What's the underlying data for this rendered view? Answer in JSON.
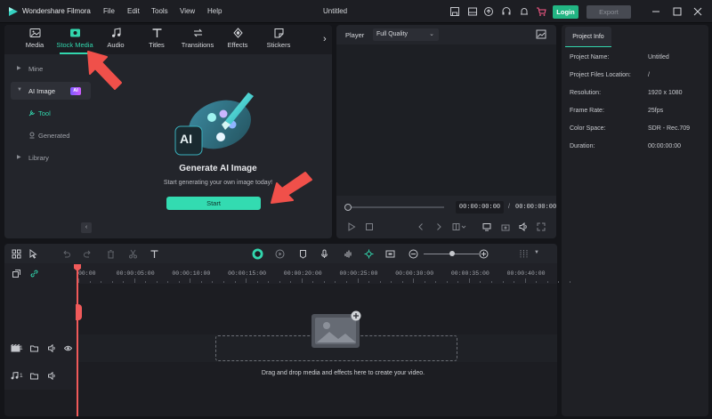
{
  "titlebar": {
    "app_name": "Wondershare Filmora",
    "menu": [
      "File",
      "Edit",
      "Tools",
      "View",
      "Help"
    ],
    "window_title": "Untitled",
    "login_label": "Login",
    "export_label": "Export"
  },
  "tabs": [
    {
      "label": "Media",
      "icon": "media-icon"
    },
    {
      "label": "Stock Media",
      "icon": "stock-media-icon",
      "active": true
    },
    {
      "label": "Audio",
      "icon": "audio-icon"
    },
    {
      "label": "Titles",
      "icon": "titles-icon"
    },
    {
      "label": "Transitions",
      "icon": "transitions-icon"
    },
    {
      "label": "Effects",
      "icon": "effects-icon"
    },
    {
      "label": "Stickers",
      "icon": "stickers-icon"
    }
  ],
  "sidebar": {
    "items": [
      {
        "label": "Mine"
      },
      {
        "label": "AI Image",
        "badge": "AI"
      },
      {
        "label": "Tool"
      },
      {
        "label": "Generated"
      },
      {
        "label": "Library"
      }
    ]
  },
  "ai_panel": {
    "logo_text": "AI",
    "title": "Generate AI Image",
    "subtitle": "Start generating your own image today!",
    "start_label": "Start"
  },
  "player": {
    "label": "Player",
    "quality": "Full Quality",
    "timecode_current": "00:00:00:00",
    "separator": "/",
    "timecode_total": "00:00:00:00"
  },
  "project_info": {
    "tab": "Project Info",
    "rows": [
      {
        "key": "Project Name:",
        "value": "Untitled"
      },
      {
        "key": "Project Files Location:",
        "value": "/"
      },
      {
        "key": "Resolution:",
        "value": "1920 x 1080"
      },
      {
        "key": "Frame Rate:",
        "value": "25fps"
      },
      {
        "key": "Color Space:",
        "value": "SDR - Rec.709"
      },
      {
        "key": "Duration:",
        "value": "00:00:00:00"
      }
    ]
  },
  "timeline": {
    "ruler": [
      "00:00",
      "00:00:05:00",
      "00:00:10:00",
      "00:00:15:00",
      "00:00:20:00",
      "00:00:25:00",
      "00:00:30:00",
      "00:00:35:00",
      "00:00:40:00"
    ],
    "video_track_num": "1",
    "audio_track_num": "1",
    "drop_hint": "Drag and drop media and effects here to create your video."
  },
  "colors": {
    "accent": "#32d6ad",
    "login": "#22b583",
    "playhead": "#f05a5a",
    "annotation_arrow": "#f0504a"
  }
}
